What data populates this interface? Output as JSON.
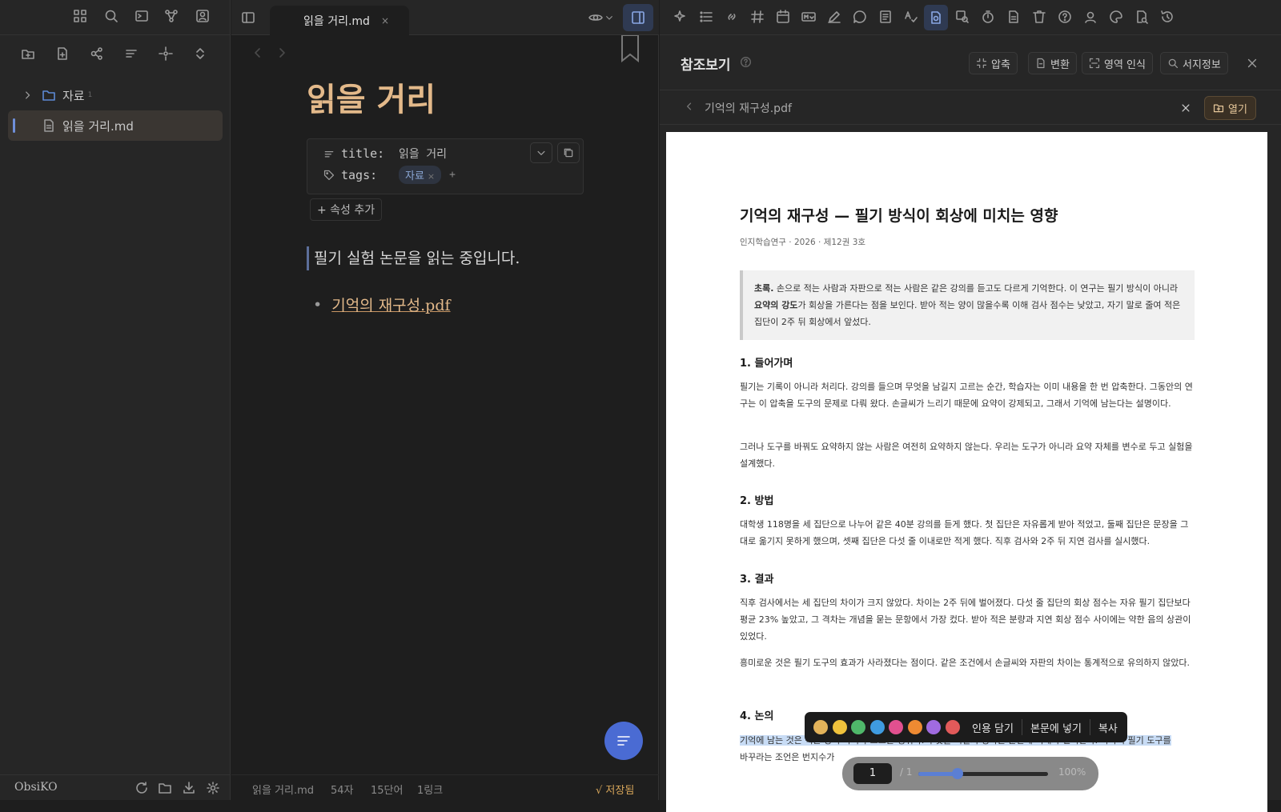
{
  "sidebar": {
    "ribbon_icons": [
      "grid-icon",
      "search-icon",
      "terminal-icon",
      "graph-icon",
      "profile-icon"
    ],
    "tool_icons": [
      "new-folder-icon",
      "new-note-icon",
      "nodes-icon",
      "sort-icon",
      "crosshair-icon",
      "collapse-icon"
    ],
    "tree": [
      {
        "type": "folder",
        "label": "자료",
        "count": "1"
      },
      {
        "type": "file",
        "label": "읽을 거리.md",
        "active": true
      }
    ],
    "vault_name": "ObsiKO",
    "footer_icons": [
      "refresh-icon",
      "folder-icon",
      "download-icon",
      "gear-icon"
    ]
  },
  "editor": {
    "tab_label": "읽을 거리.md",
    "tab_close": "×",
    "note_title": "읽을 거리",
    "properties": [
      {
        "key": "title:",
        "value": "읽을 거리"
      },
      {
        "key": "tags:",
        "tag": "자료",
        "tag_close": "×",
        "add": "+"
      }
    ],
    "add_property": "+ 속성 추가",
    "body_text": "필기 실험 논문을 읽는 중입니다.",
    "bullet_dot": "•",
    "link_text": "기억의 재구성.pdf",
    "status": {
      "file": "읽을 거리.md",
      "chars": "54자",
      "words": "15단어",
      "links": "1링크",
      "saved": "√ 저장됨"
    }
  },
  "panel": {
    "title": "참조보기",
    "buttons": {
      "compress": "압축",
      "convert": "변환",
      "ocr": "영역 인식",
      "bibinfo": "서지정보"
    },
    "file_name": "기억의 재구성.pdf",
    "open_label": "열기",
    "pdf": {
      "title": "기억의 재구성 — 필기 방식이 회상에 미치는 영향",
      "meta": "인지학습연구 · 2026 · 제12권 3호",
      "abstract_label": "초록.",
      "abstract_1": " 손으로 적는 사람과 자판으로 적는 사람은 같은 강의를 듣고도 다르게 기억한다. 이 연구는 필기 방식이 아니라 ",
      "abstract_bold": "요약의 강도",
      "abstract_2": "가 회상을 가른다는 점을 보인다. 받아 적는 양이 많을수록 이해 검사 점수는 낮았고, 자기 말로 줄여 적은 집단이 2주 뒤 회상에서 앞섰다.",
      "sections": [
        {
          "heading": "1. 들어가며",
          "paras": [
            "필기는 기록이 아니라 처리다. 강의를 들으며 무엇을 남길지 고르는 순간, 학습자는 이미 내용을 한 번 압축한다. 그동안의 연구는 이 압축을 도구의 문제로 다뤄 왔다. 손글씨가 느리기 때문에 요약이 강제되고, 그래서 기억에 남는다는 설명이다.",
            "그러나 도구를 바꿔도 요약하지 않는 사람은 여전히 요약하지 않는다. 우리는 도구가 아니라 요약 자체를 변수로 두고 실험을 설계했다."
          ]
        },
        {
          "heading": "2. 방법",
          "paras": [
            "대학생 118명을 세 집단으로 나누어 같은 40분 강의를 듣게 했다. 첫 집단은 자유롭게 받아 적었고, 둘째 집단은 문장을 그대로 옮기지 못하게 했으며, 셋째 집단은 다섯 줄 이내로만 적게 했다. 직후 검사와 2주 뒤 지연 검사를 실시했다."
          ]
        },
        {
          "heading": "3. 결과",
          "paras": [
            "직후 검사에서는 세 집단의 차이가 크지 않았다. 차이는 2주 뒤에 벌어졌다. 다섯 줄 집단의 회상 점수는 자유 필기 집단보다 평균 23% 높았고, 그 격차는 개념을 묻는 문항에서 가장 컸다. 받아 적은 분량과 지연 회상 점수 사이에는 약한 음의 상관이 있었다.",
            "흥미로운 것은 필기 도구의 효과가 사라졌다는 점이다. 같은 조건에서 손글씨와 자판의 차이는 통계적으로 유의하지 않았다."
          ]
        },
        {
          "heading": "4. 논의",
          "paras": []
        }
      ],
      "discussion_hl": "기억에 남는 것은 적은 양이 아니라 고르는 행위다. 무엇을 버릴지 정하는 순간에 이해가 일어난다. 따라서 필기 도구를",
      "discussion_rest": "바꾸라는 조언은 번지수가"
    },
    "popup": {
      "colors": [
        "#e3b35a",
        "#f0c23c",
        "#4fb86a",
        "#3f9be0",
        "#e2508f",
        "#ee8a32",
        "#a06be0",
        "#e25a5a"
      ],
      "quote": "인용 담기",
      "insert": "본문에 넣기",
      "copy": "복사"
    },
    "page": {
      "current": "1",
      "total": "/ 1",
      "zoom": "100%",
      "zoom_level": 0.3
    }
  }
}
